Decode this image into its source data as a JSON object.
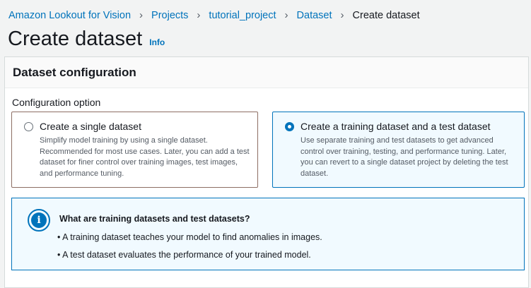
{
  "breadcrumb": {
    "items": [
      "Amazon Lookout for Vision",
      "Projects",
      "tutorial_project",
      "Dataset"
    ],
    "current": "Create dataset"
  },
  "header": {
    "title": "Create dataset",
    "info": "Info"
  },
  "panel": {
    "title": "Dataset configuration",
    "config_label": "Configuration option",
    "options": [
      {
        "title": "Create a single dataset",
        "description": "Simplify model training by using a single dataset. Recommended for most use cases. Later, you can add a test dataset for finer control over training images, test images, and performance tuning.",
        "selected": false
      },
      {
        "title": "Create a training dataset and a test dataset",
        "description": "Use separate training and test datasets to get advanced control over training, testing, and performance tuning. Later, you can revert to a single dataset project by deleting the test dataset.",
        "selected": true
      }
    ]
  },
  "alert": {
    "icon": "info-icon",
    "title": "What are training datasets and test datasets?",
    "bullets": [
      "A training dataset teaches your model to find anomalies in images.",
      "A test dataset evaluates the performance of your trained model."
    ]
  },
  "colors": {
    "link": "#0073bb",
    "text": "#16191f",
    "selected_bg": "#f1faff"
  }
}
